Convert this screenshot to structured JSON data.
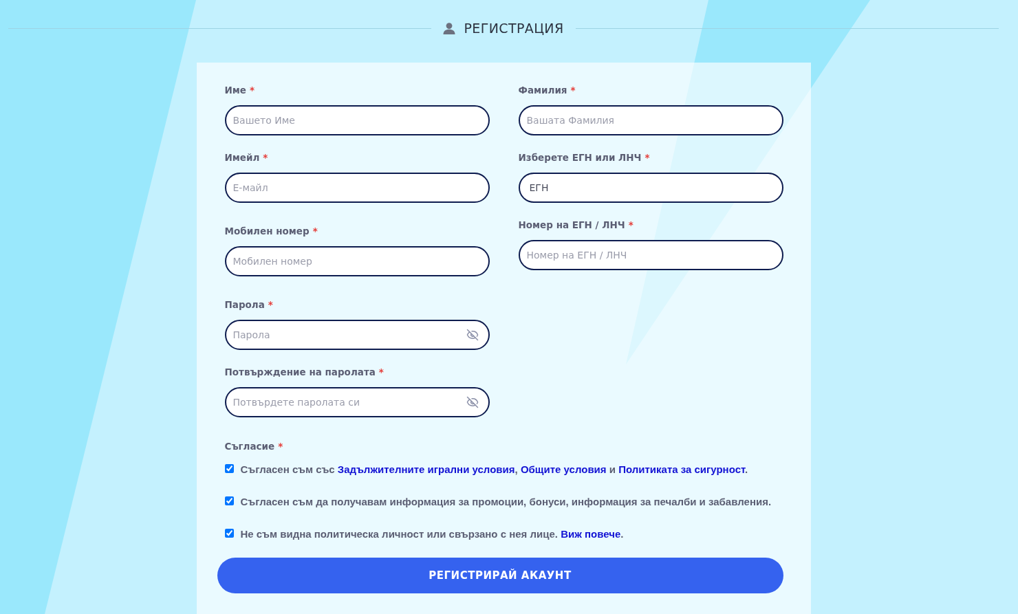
{
  "header": {
    "title": "РЕГИСТРАЦИЯ"
  },
  "form": {
    "left_column": [
      {
        "kind": "text",
        "label": "Име",
        "required_mark": "*",
        "placeholder": "Вашето Име"
      },
      {
        "kind": "text",
        "label": "Имейл",
        "required_mark": "*",
        "placeholder": "Е-майл"
      },
      {
        "kind": "text",
        "label": "Мобилен номер",
        "required_mark": "*",
        "placeholder": "Мобилен номер"
      },
      {
        "kind": "password",
        "label": "Парола",
        "required_mark": "*",
        "placeholder": "Парола"
      },
      {
        "kind": "password",
        "label": "Потвърждение на паролата",
        "required_mark": "*",
        "placeholder": "Потвърдете паролата си"
      }
    ],
    "right_column": [
      {
        "kind": "text",
        "label": "Фамилия",
        "required_mark": "*",
        "placeholder": "Вашата Фамилия"
      },
      {
        "kind": "select",
        "label": "Изберете ЕГН или ЛНЧ",
        "required_mark": "*",
        "value": "ЕГН"
      },
      {
        "kind": "text",
        "label": "Номер на ЕГН / ЛНЧ",
        "required_mark": "*",
        "placeholder": "Номер на ЕГН / ЛНЧ"
      }
    ],
    "consent": {
      "label": "Съгласие",
      "required_mark": "*",
      "items": [
        {
          "checked": true,
          "parts": [
            {
              "kind": "text",
              "text": "Съгласен съм със "
            },
            {
              "kind": "link",
              "text": "Задължителните игрални условия"
            },
            {
              "kind": "text",
              "text": ", "
            },
            {
              "kind": "link",
              "text": "Общите условия"
            },
            {
              "kind": "text",
              "text": " и "
            },
            {
              "kind": "link",
              "text": "Политиката за сигурност"
            },
            {
              "kind": "text",
              "text": "."
            }
          ]
        },
        {
          "checked": true,
          "parts": [
            {
              "kind": "text",
              "text": "Съгласен съм да получавам информация за промоции, бонуси, информация за печалби и забавления."
            }
          ]
        },
        {
          "checked": true,
          "parts": [
            {
              "kind": "text",
              "text": "Не съм видна политическа личност или свързано с нея лице. "
            },
            {
              "kind": "link",
              "text": "Виж повече"
            },
            {
              "kind": "text",
              "text": "."
            }
          ]
        }
      ]
    },
    "submit_button": {
      "label": "РЕГИСТРИРАЙ АКАУНТ"
    }
  }
}
